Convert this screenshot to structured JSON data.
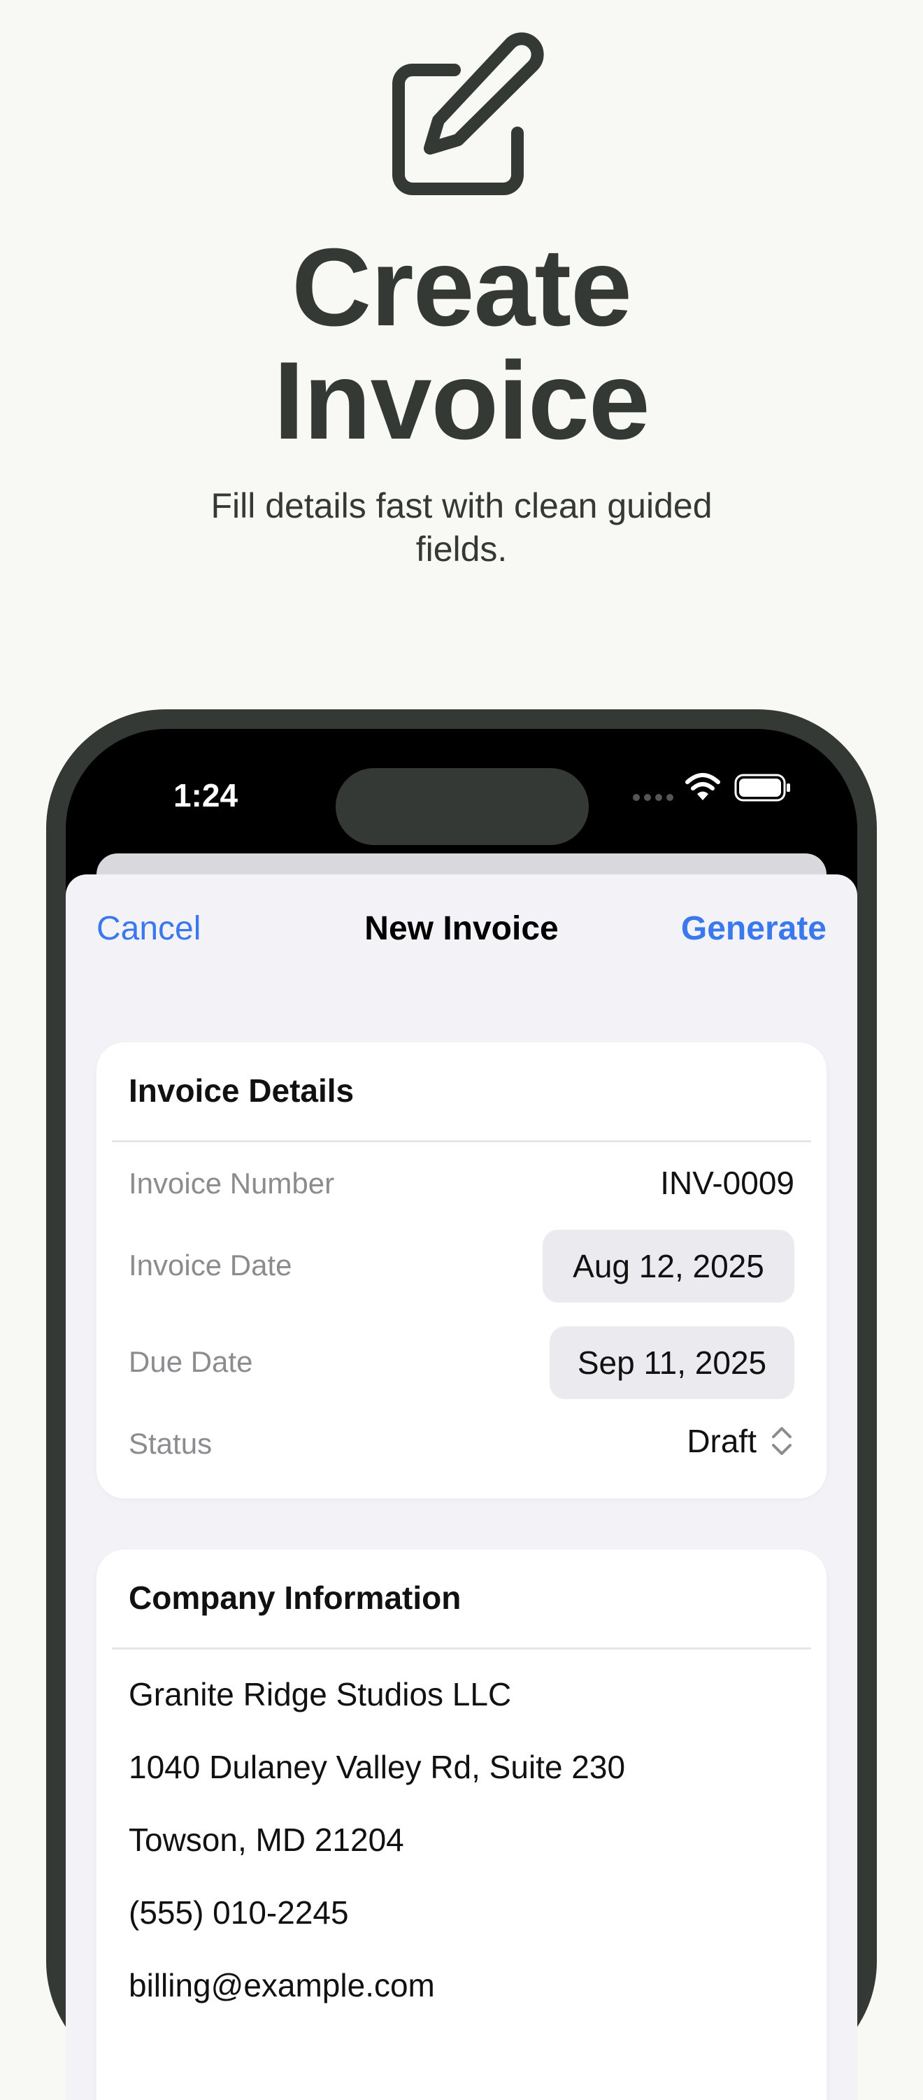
{
  "hero": {
    "icon": "edit-pencil-icon",
    "title_line1": "Create",
    "title_line2": "Invoice",
    "subtitle_line1": "Fill details fast with clean guided",
    "subtitle_line2": "fields."
  },
  "status_bar": {
    "time": "1:24",
    "icons": [
      "signal-icon",
      "wifi-icon",
      "battery-icon"
    ]
  },
  "nav": {
    "cancel": "Cancel",
    "title": "New Invoice",
    "generate": "Generate"
  },
  "invoice_details": {
    "title": "Invoice Details",
    "rows": [
      {
        "label": "Invoice Number",
        "value": "INV-0009"
      },
      {
        "label": "Invoice Date",
        "value": "Aug 12, 2025"
      },
      {
        "label": "Due Date",
        "value": "Sep 11, 2025"
      },
      {
        "label": "Status",
        "value": "Draft"
      }
    ]
  },
  "company": {
    "title": "Company Information",
    "lines": [
      "Granite Ridge Studios LLC",
      "1040 Dulaney Valley Rd, Suite 230",
      "Towson, MD 21204",
      "(555) 010-2245",
      "billing@example.com"
    ]
  },
  "colors": {
    "background": "#f8f8f4",
    "accent": "#3a78ee",
    "dark": "#353935"
  }
}
